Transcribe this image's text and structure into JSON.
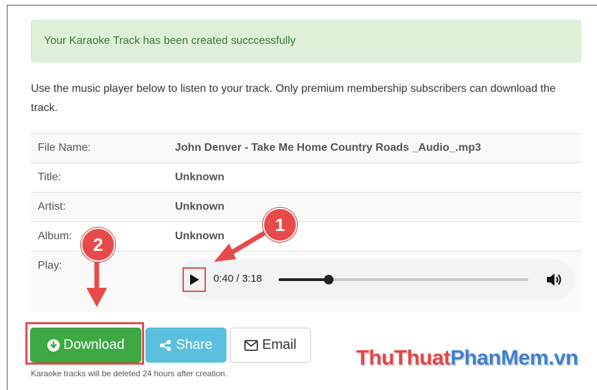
{
  "alert": {
    "text": "Your Karaoke Track has been created succcessfully"
  },
  "description": "Use the music player below to listen to your track. Only premium membership subscribers can download the track.",
  "info": [
    {
      "label": "File Name:",
      "value": "John Denver - Take Me Home Country Roads _Audio_.mp3"
    },
    {
      "label": "Title:",
      "value": "Unknown"
    },
    {
      "label": "Artist:",
      "value": "Unknown"
    },
    {
      "label": "Album:",
      "value": "Unknown"
    }
  ],
  "play_label": "Play:",
  "player": {
    "time": "0:40 / 3:18",
    "progress_fraction": 0.2
  },
  "buttons": {
    "download": "Download",
    "share": "Share",
    "email": "Email"
  },
  "note": "Karaoke tracks will be deleted 24 hours after creation.",
  "callouts": {
    "one": "1",
    "two": "2"
  },
  "watermark": {
    "part1": "ThuThuat",
    "part2": "PhanMem.vn"
  },
  "colors": {
    "alert_bg": "#dff0d8",
    "download": "#3ea845",
    "share": "#5bc0de",
    "annotation": "#e84a4a"
  },
  "icons": {
    "play": "play-icon",
    "volume": "volume-icon",
    "download": "download-circle-icon",
    "share": "share-icon",
    "email": "envelope-icon"
  }
}
